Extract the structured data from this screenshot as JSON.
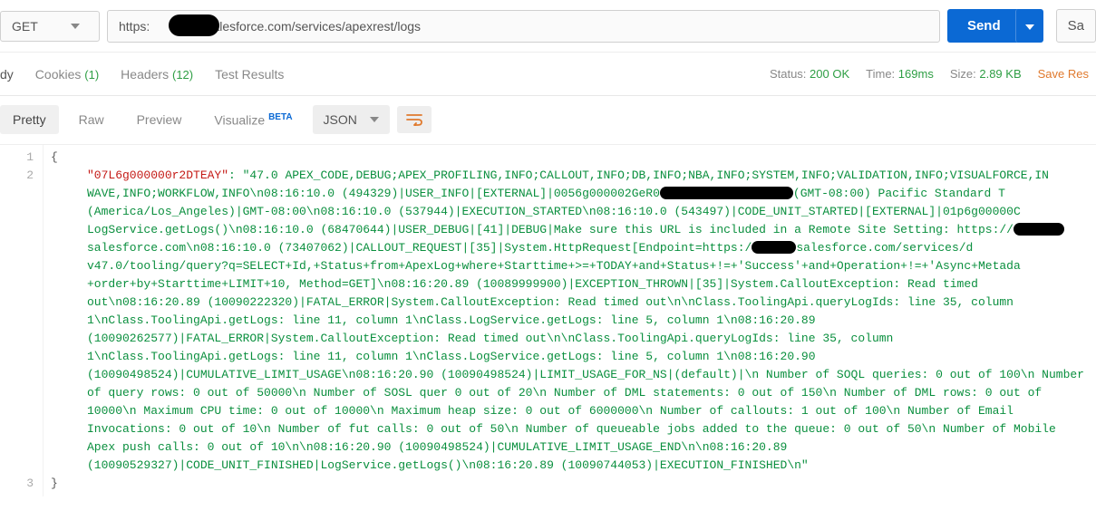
{
  "request": {
    "method": "GET",
    "url": "https:               .salesforce.com/services/apexrest/logs"
  },
  "buttons": {
    "send": "Send",
    "save": "Sa"
  },
  "tabs": {
    "body": "dy",
    "cookies": "Cookies",
    "cookies_count": "(1)",
    "headers": "Headers",
    "headers_count": "(12)",
    "test_results": "Test Results"
  },
  "status": {
    "status_label": "Status:",
    "status_value": "200 OK",
    "time_label": "Time:",
    "time_value": "169ms",
    "size_label": "Size:",
    "size_value": "2.89 KB",
    "save_response": "Save Res"
  },
  "view": {
    "pretty": "Pretty",
    "raw": "Raw",
    "preview": "Preview",
    "visualize": "Visualize",
    "beta": "BETA",
    "format": "JSON"
  },
  "json": {
    "brace_open": "{",
    "brace_close": "}",
    "key": "\"07L6g000000r2DTEAY\"",
    "value": ": \"47.0 APEX_CODE,DEBUG;APEX_PROFILING,INFO;CALLOUT,INFO;DB,INFO;NBA,INFO;SYSTEM,INFO;VALIDATION,INFO;VISUALFORCE,IN WAVE,INFO;WORKFLOW,INFO\\n08:16:10.0 (494329)|USER_INFO|[EXTERNAL]|0056g000002GeR0                     (GMT-08:00) Pacific Standard T (America/Los_Angeles)|GMT-08:00\\n08:16:10.0 (537944)|EXECUTION_STARTED\\n08:16:10.0 (543497)|CODE_UNIT_STARTED|[EXTERNAL]|01p6g00000C LogService.getLogs()\\n08:16:10.0 (68470644)|USER_DEBUG|[41]|DEBUG|Make sure this URL is included in a Remote Site Setting: https://        salesforce.com\\n08:16:10.0 (73407062)|CALLOUT_REQUEST|[35]|System.HttpRequest[Endpoint=https:/       salesforce.com/services/d v47.0/tooling/query?q=SELECT+Id,+Status+from+ApexLog+where+Starttime+>=+TODAY+and+Status+!=+'Success'+and+Operation+!=+'Async+Metada +order+by+Starttime+LIMIT+10, Method=GET]\\n08:16:20.89 (10089999900)|EXCEPTION_THROWN|[35]|System.CalloutException: Read timed out\\n08:16:20.89 (10090222320)|FATAL_ERROR|System.CalloutException: Read timed out\\n\\nClass.ToolingApi.queryLogIds: line 35, column 1\\nClass.ToolingApi.getLogs: line 11, column 1\\nClass.LogService.getLogs: line 5, column 1\\n08:16:20.89 (10090262577)|FATAL_ERROR|System.CalloutException: Read timed out\\n\\nClass.ToolingApi.queryLogIds: line 35, column 1\\nClass.ToolingApi.getLogs: line 11, column 1\\nClass.LogService.getLogs: line 5, column 1\\n08:16:20.90 (10090498524)|CUMULATIVE_LIMIT_USAGE\\n08:16:20.90 (10090498524)|LIMIT_USAGE_FOR_NS|(default)|\\n  Number of SOQL queries: 0 out of 100\\n  Number of query rows: 0 out of 50000\\n  Number of SOSL quer 0 out of 20\\n  Number of DML statements: 0 out of 150\\n  Number of DML rows: 0 out of 10000\\n  Maximum CPU time: 0 out of 10000\\n  Maximum heap size: 0 out of 6000000\\n  Number of callouts: 1 out of 100\\n  Number of Email Invocations: 0 out of 10\\n  Number of fut calls: 0 out of 50\\n  Number of queueable jobs added to the queue: 0 out of 50\\n  Number of Mobile Apex push calls: 0 out of 10\\n\\n08:16:20.90 (10090498524)|CUMULATIVE_LIMIT_USAGE_END\\n\\n08:16:20.89 (10090529327)|CODE_UNIT_FINISHED|LogService.getLogs()\\n08:16:20.89 (10090744053)|EXECUTION_FINISHED\\n\""
  }
}
